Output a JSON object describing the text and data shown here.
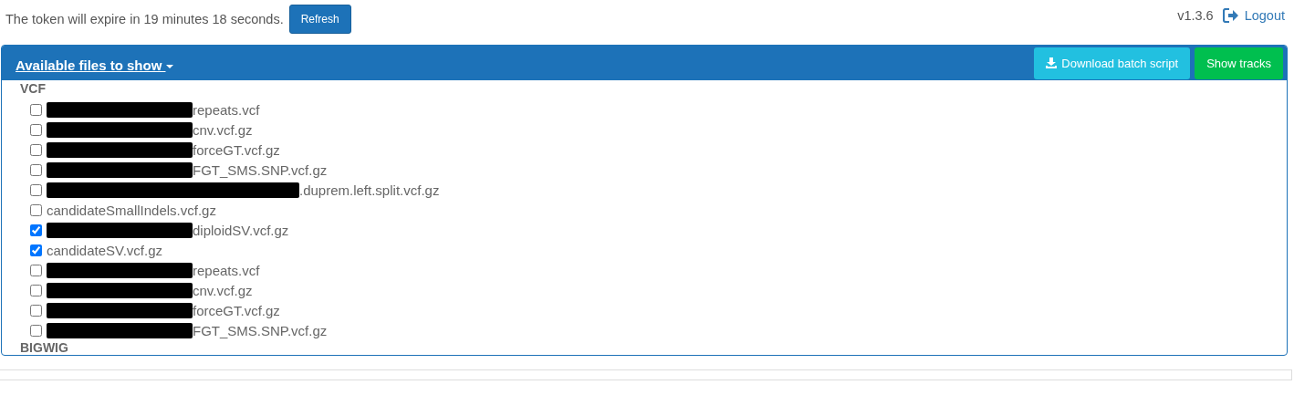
{
  "token_notice": "The token will expire in 19 minutes 18 seconds.",
  "refresh_button": "Refresh",
  "version": "v1.3.6",
  "logout_link": "Logout",
  "panel": {
    "title": "Available files to show",
    "download_button": "Download batch script",
    "show_button": "Show tracks",
    "groups": [
      {
        "name": "VCF",
        "files": [
          {
            "name": "repeats.vcf",
            "checked": false,
            "kind": "redacted"
          },
          {
            "name": "cnv.vcf.gz",
            "checked": false,
            "kind": "redacted"
          },
          {
            "name": "forceGT.vcf.gz",
            "checked": false,
            "kind": "redacted"
          },
          {
            "name": "FGT_SMS.SNP.vcf.gz",
            "checked": false,
            "kind": "redacted"
          },
          {
            "name": ".duprem.left.split.vcf.gz",
            "checked": false,
            "kind": "redacted-wide"
          },
          {
            "name": "candidateSmallIndels.vcf.gz",
            "checked": false,
            "kind": "plain"
          },
          {
            "name": "diploidSV.vcf.gz",
            "checked": true,
            "kind": "redacted"
          },
          {
            "name": "candidateSV.vcf.gz",
            "checked": true,
            "kind": "plain"
          },
          {
            "name": "repeats.vcf",
            "checked": false,
            "kind": "redacted"
          },
          {
            "name": "cnv.vcf.gz",
            "checked": false,
            "kind": "redacted"
          },
          {
            "name": "forceGT.vcf.gz",
            "checked": false,
            "kind": "redacted"
          },
          {
            "name": "FGT_SMS.SNP.vcf.gz",
            "checked": false,
            "kind": "redacted"
          }
        ]
      },
      {
        "name": "BIGWIG"
      }
    ]
  }
}
